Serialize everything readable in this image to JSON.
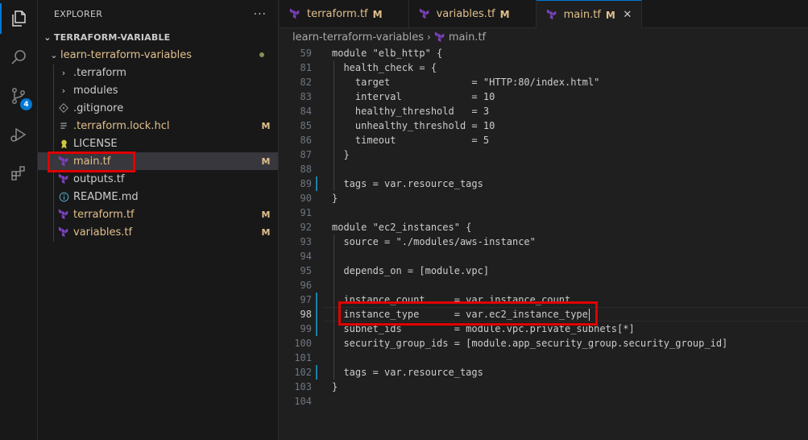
{
  "sidebar": {
    "title": "EXPLORER",
    "more_label": "···",
    "root_label": "TERRAFORM-VARIABLE",
    "folder_label": "learn-terraform-variables",
    "items": [
      {
        "label": ".terraform",
        "type": "folder",
        "status": ""
      },
      {
        "label": "modules",
        "type": "folder",
        "status": ""
      },
      {
        "label": ".gitignore",
        "type": "gitignore",
        "status": ""
      },
      {
        "label": ".terraform.lock.hcl",
        "type": "lock",
        "status": "M"
      },
      {
        "label": "LICENSE",
        "type": "license",
        "status": ""
      },
      {
        "label": "main.tf",
        "type": "tf",
        "status": "M"
      },
      {
        "label": "outputs.tf",
        "type": "tf",
        "status": ""
      },
      {
        "label": "README.md",
        "type": "info",
        "status": ""
      },
      {
        "label": "terraform.tf",
        "type": "tf",
        "status": "M"
      },
      {
        "label": "variables.tf",
        "type": "tf",
        "status": "M"
      }
    ]
  },
  "activity": {
    "scm_badge": "4"
  },
  "tabs": [
    {
      "label": "terraform.tf",
      "status": "M"
    },
    {
      "label": "variables.tf",
      "status": "M"
    },
    {
      "label": "main.tf",
      "status": "M",
      "close": "✕"
    }
  ],
  "breadcrumb": {
    "folder": "learn-terraform-variables",
    "separator": "›",
    "file": "main.tf"
  },
  "code_lines": [
    {
      "num": "59",
      "text": "module \"elb_http\" {"
    },
    {
      "num": "81",
      "text": "  health_check = {"
    },
    {
      "num": "82",
      "text": "    target              = \"HTTP:80/index.html\""
    },
    {
      "num": "83",
      "text": "    interval            = 10"
    },
    {
      "num": "84",
      "text": "    healthy_threshold   = 3"
    },
    {
      "num": "85",
      "text": "    unhealthy_threshold = 10"
    },
    {
      "num": "86",
      "text": "    timeout             = 5"
    },
    {
      "num": "87",
      "text": "  }"
    },
    {
      "num": "88",
      "text": ""
    },
    {
      "num": "89",
      "text": "  tags = var.resource_tags"
    },
    {
      "num": "90",
      "text": "}"
    },
    {
      "num": "91",
      "text": ""
    },
    {
      "num": "92",
      "text": "module \"ec2_instances\" {"
    },
    {
      "num": "93",
      "text": "  source = \"./modules/aws-instance\""
    },
    {
      "num": "94",
      "text": ""
    },
    {
      "num": "95",
      "text": "  depends_on = [module.vpc]"
    },
    {
      "num": "96",
      "text": ""
    },
    {
      "num": "97",
      "text": "  instance_count     = var.instance_count"
    },
    {
      "num": "98",
      "text": "  instance_type      = var.ec2_instance_type"
    },
    {
      "num": "99",
      "text": "  subnet_ids         = module.vpc.private_subnets[*]"
    },
    {
      "num": "100",
      "text": "  security_group_ids = [module.app_security_group.security_group_id]"
    },
    {
      "num": "101",
      "text": ""
    },
    {
      "num": "102",
      "text": "  tags = var.resource_tags"
    },
    {
      "num": "103",
      "text": "}"
    },
    {
      "num": "104",
      "text": ""
    }
  ],
  "colors": {
    "accent": "#0078d4",
    "modified": "#e2c08d",
    "terraform_icon": "#7b42bc",
    "highlight_box": "#e00000"
  }
}
